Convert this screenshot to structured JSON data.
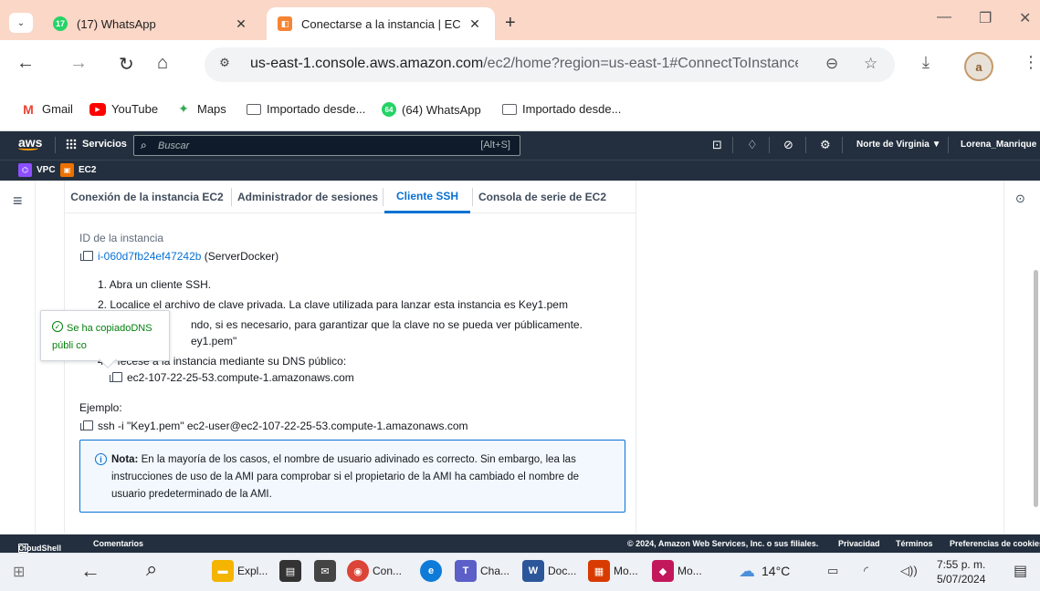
{
  "browser": {
    "tabs": [
      {
        "title": "(17) WhatsApp",
        "badge": "17"
      },
      {
        "title": "Conectarse a la instancia | EC"
      }
    ],
    "url_main": "us-east-1.console.aws.amazon.com",
    "url_rest": "/ec2/home?region=us-east-1#ConnectToInstance:i...",
    "bookmarks": [
      "Gmail",
      "YouTube",
      "Maps",
      "Importado desde...",
      "(64) WhatsApp",
      "Importado desde..."
    ],
    "bookmark_badge": "64"
  },
  "aws_nav": {
    "logo": "aws",
    "services": "Servicios",
    "search_placeholder": "Buscar",
    "search_shortcut": "[Alt+S]",
    "region": "Norte de Virginia ▼",
    "user": "Lorena_Manrique ▼",
    "favorites": [
      "VPC",
      "EC2"
    ]
  },
  "connect": {
    "tabs": [
      "Conexión de la instancia EC2",
      "Administrador de sesiones",
      "Cliente SSH",
      "Consola de serie de EC2"
    ],
    "selected_tab": "Cliente SSH",
    "instance_label": "ID de la instancia",
    "instance_id": "i-060d7fb24ef47242b",
    "instance_name": "(ServerDocker)",
    "step1": "1. Abra un cliente SSH.",
    "step2": "2. Localice el archivo de clave privada. La clave utilizada para lanzar esta instancia es Key1.pem",
    "step3_partial": "ndo, si es necesario, para garantizar que la clave no se pueda ver públicamente.",
    "step3_cmd_partial": "ey1.pem\"",
    "step4_prefix": "4.",
    "step4_partial": "ıecese a la instancia mediante su DNS público:",
    "dns": "ec2-107-22-25-53.compute-1.amazonaws.com",
    "example_label": "Ejemplo:",
    "example_cmd": "ssh -i \"Key1.pem\" ec2-user@ec2-107-22-25-53.compute-1.amazonaws.com",
    "note_bold": "Nota:",
    "note_text": " En la mayoría de los casos, el nombre de usuario adivinado es correcto. Sin embargo, lea las instrucciones de uso de la AMI para comprobar si el propietario de la AMI ha cambiado el nombre de usuario predeterminado de la AMI.",
    "toast": "Se ha copiadoDNS públi co"
  },
  "aws_footer": {
    "cloudshell": "CloudShell",
    "comentarios": "Comentarios",
    "copyright": "© 2024, Amazon Web Services, Inc. o sus filiales.",
    "privacidad": "Privacidad",
    "terminos": "Términos",
    "cookies": "Preferencias de cookies"
  },
  "taskbar": {
    "apps": [
      "Expl...",
      "Con...",
      "Cha...",
      "Doc...",
      "Mo...",
      "Mo..."
    ],
    "weather": "14°C",
    "time": "7:55 p. m.",
    "date": "5/07/2024"
  },
  "colors": {
    "aws_nav": "#232f3e",
    "link": "#0972d3",
    "success": "#037f0c",
    "tabbar": "#fbd7c7"
  }
}
